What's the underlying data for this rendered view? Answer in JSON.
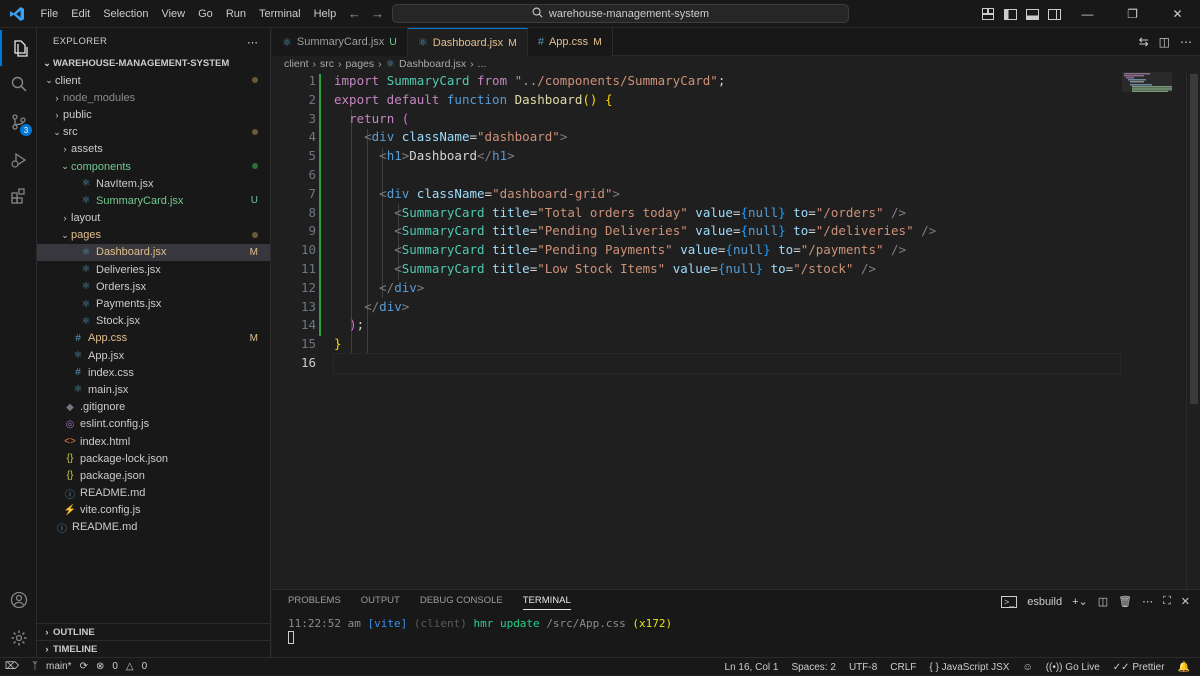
{
  "menu": [
    "File",
    "Edit",
    "Selection",
    "View",
    "Go",
    "Run",
    "Terminal",
    "Help"
  ],
  "search_text": "warehouse-management-system",
  "explorer": {
    "title": "EXPLORER",
    "root": "WAREHOUSE-MANAGEMENT-SYSTEM",
    "items": [
      {
        "label": "client",
        "depth": 0,
        "type": "folder-open",
        "status": "dot"
      },
      {
        "label": "node_modules",
        "depth": 1,
        "type": "folder",
        "dim": true
      },
      {
        "label": "public",
        "depth": 1,
        "type": "folder"
      },
      {
        "label": "src",
        "depth": 1,
        "type": "folder-open",
        "status": "dot"
      },
      {
        "label": "assets",
        "depth": 2,
        "type": "folder"
      },
      {
        "label": "components",
        "depth": 2,
        "type": "folder-open",
        "status": "dotg",
        "color": "#73c991"
      },
      {
        "label": "NavItem.jsx",
        "depth": 3,
        "type": "react"
      },
      {
        "label": "SummaryCard.jsx",
        "depth": 3,
        "type": "react",
        "status": "U",
        "color": "#73c991"
      },
      {
        "label": "layout",
        "depth": 2,
        "type": "folder"
      },
      {
        "label": "pages",
        "depth": 2,
        "type": "folder-open",
        "status": "dot",
        "color": "#e2c08d"
      },
      {
        "label": "Dashboard.jsx",
        "depth": 3,
        "type": "react",
        "status": "M",
        "color": "#e2c08d",
        "selected": true
      },
      {
        "label": "Deliveries.jsx",
        "depth": 3,
        "type": "react"
      },
      {
        "label": "Orders.jsx",
        "depth": 3,
        "type": "react"
      },
      {
        "label": "Payments.jsx",
        "depth": 3,
        "type": "react"
      },
      {
        "label": "Stock.jsx",
        "depth": 3,
        "type": "react"
      },
      {
        "label": "App.css",
        "depth": 2,
        "type": "css",
        "status": "M",
        "color": "#e2c08d"
      },
      {
        "label": "App.jsx",
        "depth": 2,
        "type": "react"
      },
      {
        "label": "index.css",
        "depth": 2,
        "type": "css"
      },
      {
        "label": "main.jsx",
        "depth": 2,
        "type": "react"
      },
      {
        "label": ".gitignore",
        "depth": 1,
        "type": "git"
      },
      {
        "label": "eslint.config.js",
        "depth": 1,
        "type": "eslint"
      },
      {
        "label": "index.html",
        "depth": 1,
        "type": "html"
      },
      {
        "label": "package-lock.json",
        "depth": 1,
        "type": "json"
      },
      {
        "label": "package.json",
        "depth": 1,
        "type": "json"
      },
      {
        "label": "README.md",
        "depth": 1,
        "type": "info"
      },
      {
        "label": "vite.config.js",
        "depth": 1,
        "type": "vite"
      },
      {
        "label": "README.md",
        "depth": 0,
        "type": "info"
      }
    ],
    "outline": "OUTLINE",
    "timeline": "TIMELINE"
  },
  "tabs": [
    {
      "label": "SummaryCard.jsx",
      "mark": "U",
      "active": false
    },
    {
      "label": "Dashboard.jsx",
      "mark": "M",
      "active": true
    },
    {
      "label": "App.css",
      "mark": "M",
      "active": false
    }
  ],
  "breadcrumbs": [
    "client",
    "src",
    "pages",
    "Dashboard.jsx",
    "..."
  ],
  "line_numbers": [
    "1",
    "2",
    "3",
    "4",
    "5",
    "6",
    "7",
    "8",
    "9",
    "10",
    "11",
    "12",
    "13",
    "14",
    "15",
    "16"
  ],
  "current_line": 16,
  "code": [
    [
      [
        "kw",
        "import "
      ],
      [
        "comp",
        "SummaryCard"
      ],
      [
        "kw",
        " from "
      ],
      [
        "str",
        "\"../components/SummaryCard\""
      ],
      [
        "tx",
        ";"
      ]
    ],
    [
      [
        "kw",
        "export default "
      ],
      [
        "kb",
        "function "
      ],
      [
        "fn",
        "Dashboard"
      ],
      [
        "br1",
        "()"
      ],
      [
        "tx",
        " "
      ],
      [
        "br1",
        "{"
      ]
    ],
    [
      [
        "tx",
        "  "
      ],
      [
        "kw",
        "return "
      ],
      [
        "br2",
        "("
      ]
    ],
    [
      [
        "tx",
        "    "
      ],
      [
        "gray",
        "<"
      ],
      [
        "tag",
        "div"
      ],
      [
        "tx",
        " "
      ],
      [
        "attr",
        "className"
      ],
      [
        "tx",
        "="
      ],
      [
        "str",
        "\"dashboard\""
      ],
      [
        "gray",
        ">"
      ]
    ],
    [
      [
        "tx",
        "      "
      ],
      [
        "gray",
        "<"
      ],
      [
        "tag",
        "h1"
      ],
      [
        "gray",
        ">"
      ],
      [
        "tx",
        "Dashboard"
      ],
      [
        "gray",
        "</"
      ],
      [
        "tag",
        "h1"
      ],
      [
        "gray",
        ">"
      ]
    ],
    [],
    [
      [
        "tx",
        "      "
      ],
      [
        "gray",
        "<"
      ],
      [
        "tag",
        "div"
      ],
      [
        "tx",
        " "
      ],
      [
        "attr",
        "className"
      ],
      [
        "tx",
        "="
      ],
      [
        "str",
        "\"dashboard-grid\""
      ],
      [
        "gray",
        ">"
      ]
    ],
    [
      [
        "tx",
        "        "
      ],
      [
        "gray",
        "<"
      ],
      [
        "comp",
        "SummaryCard"
      ],
      [
        "tx",
        " "
      ],
      [
        "attr",
        "title"
      ],
      [
        "tx",
        "="
      ],
      [
        "str",
        "\"Total orders today\""
      ],
      [
        "tx",
        " "
      ],
      [
        "attr",
        "value"
      ],
      [
        "tx",
        "="
      ],
      [
        "br3",
        "{"
      ],
      [
        "kb",
        "null"
      ],
      [
        "br3",
        "}"
      ],
      [
        "tx",
        " "
      ],
      [
        "attr",
        "to"
      ],
      [
        "tx",
        "="
      ],
      [
        "str",
        "\"/orders\""
      ],
      [
        "tx",
        " "
      ],
      [
        "gray",
        "/>"
      ]
    ],
    [
      [
        "tx",
        "        "
      ],
      [
        "gray",
        "<"
      ],
      [
        "comp",
        "SummaryCard"
      ],
      [
        "tx",
        " "
      ],
      [
        "attr",
        "title"
      ],
      [
        "tx",
        "="
      ],
      [
        "str",
        "\"Pending Deliveries\""
      ],
      [
        "tx",
        " "
      ],
      [
        "attr",
        "value"
      ],
      [
        "tx",
        "="
      ],
      [
        "br3",
        "{"
      ],
      [
        "kb",
        "null"
      ],
      [
        "br3",
        "}"
      ],
      [
        "tx",
        " "
      ],
      [
        "attr",
        "to"
      ],
      [
        "tx",
        "="
      ],
      [
        "str",
        "\"/deliveries\""
      ],
      [
        "tx",
        " "
      ],
      [
        "gray",
        "/>"
      ]
    ],
    [
      [
        "tx",
        "        "
      ],
      [
        "gray",
        "<"
      ],
      [
        "comp",
        "SummaryCard"
      ],
      [
        "tx",
        " "
      ],
      [
        "attr",
        "title"
      ],
      [
        "tx",
        "="
      ],
      [
        "str",
        "\"Pending Payments\""
      ],
      [
        "tx",
        " "
      ],
      [
        "attr",
        "value"
      ],
      [
        "tx",
        "="
      ],
      [
        "br3",
        "{"
      ],
      [
        "kb",
        "null"
      ],
      [
        "br3",
        "}"
      ],
      [
        "tx",
        " "
      ],
      [
        "attr",
        "to"
      ],
      [
        "tx",
        "="
      ],
      [
        "str",
        "\"/payments\""
      ],
      [
        "tx",
        " "
      ],
      [
        "gray",
        "/>"
      ]
    ],
    [
      [
        "tx",
        "        "
      ],
      [
        "gray",
        "<"
      ],
      [
        "comp",
        "SummaryCard"
      ],
      [
        "tx",
        " "
      ],
      [
        "attr",
        "title"
      ],
      [
        "tx",
        "="
      ],
      [
        "str",
        "\"Low Stock Items\""
      ],
      [
        "tx",
        " "
      ],
      [
        "attr",
        "value"
      ],
      [
        "tx",
        "="
      ],
      [
        "br3",
        "{"
      ],
      [
        "kb",
        "null"
      ],
      [
        "br3",
        "}"
      ],
      [
        "tx",
        " "
      ],
      [
        "attr",
        "to"
      ],
      [
        "tx",
        "="
      ],
      [
        "str",
        "\"/stock\""
      ],
      [
        "tx",
        " "
      ],
      [
        "gray",
        "/>"
      ]
    ],
    [
      [
        "tx",
        "      "
      ],
      [
        "gray",
        "</"
      ],
      [
        "tag",
        "div"
      ],
      [
        "gray",
        ">"
      ]
    ],
    [
      [
        "tx",
        "    "
      ],
      [
        "gray",
        "</"
      ],
      [
        "tag",
        "div"
      ],
      [
        "gray",
        ">"
      ]
    ],
    [
      [
        "tx",
        "  "
      ],
      [
        "br2",
        ")"
      ],
      [
        "tx",
        ";"
      ]
    ],
    [
      [
        "br1",
        "}"
      ]
    ],
    []
  ],
  "panel": {
    "tabs": [
      "PROBLEMS",
      "OUTPUT",
      "DEBUG CONSOLE",
      "TERMINAL"
    ],
    "active_tab": "TERMINAL",
    "shell": "esbuild",
    "terminal_line": [
      [
        "#8b8b8b",
        "11:22:52 am "
      ],
      [
        "#3b8eea",
        "[vite] "
      ],
      [
        "#5a5a5a",
        "(client) "
      ],
      [
        "#23d18b",
        "hmr update "
      ],
      [
        "#8b8b8b",
        "/src/App.css "
      ],
      [
        "#e5e510",
        "(x172)"
      ]
    ]
  },
  "status": {
    "branch": "main*",
    "errors": "0",
    "warnings": "0",
    "position": "Ln 16, Col 1",
    "spaces": "Spaces: 2",
    "encoding": "UTF-8",
    "eol": "CRLF",
    "language": "JavaScript JSX",
    "golive": "Go Live",
    "prettier": "Prettier"
  }
}
